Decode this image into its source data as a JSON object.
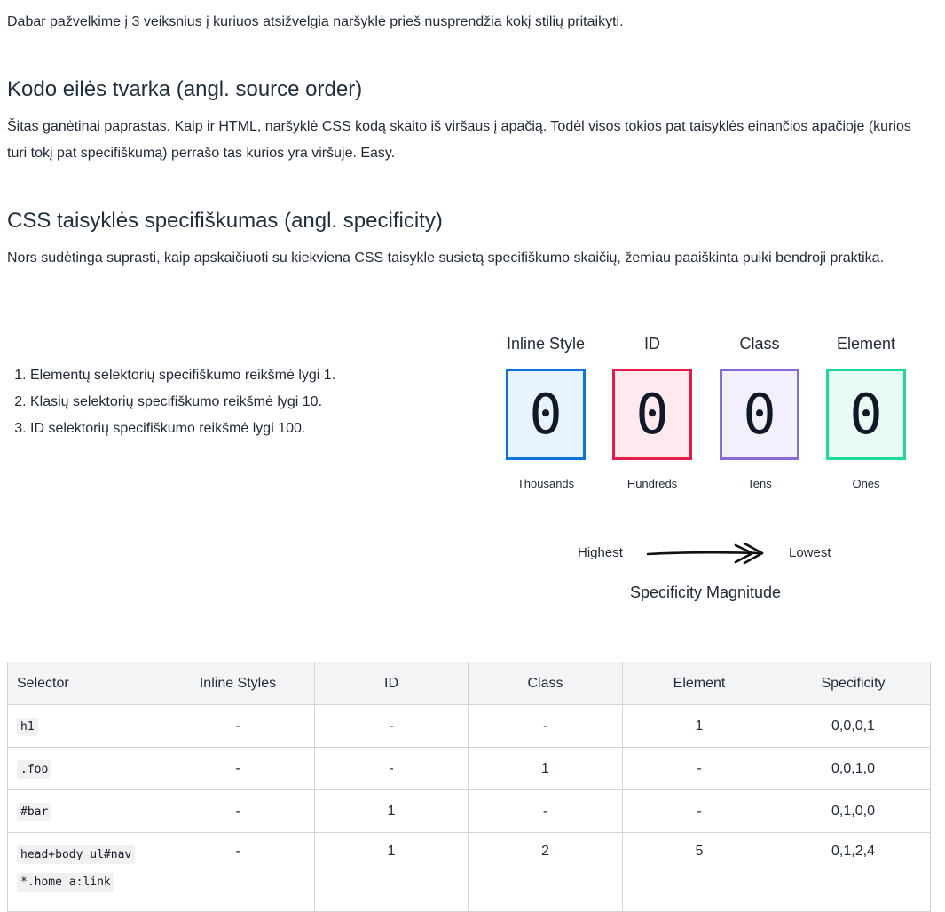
{
  "intro": "Dabar pažvelkime į 3 veiksnius į kuriuos atsižvelgia naršyklė prieš nusprendžia kokį stilių pritaikyti.",
  "section1": {
    "heading": "Kodo eilės tvarka (angl. source order)",
    "text": "Šitas ganėtinai paprastas. Kaip ir HTML, naršyklė CSS kodą skaito iš viršaus į apačią. Todėl visos tokios pat taisyklės einančios apačioje (kurios turi tokį pat specifiškumą) perrašo tas kurios yra viršuje. Easy."
  },
  "section2": {
    "heading": "CSS taisyklės specifiškumas (angl. specificity)",
    "text": "Nors sudėtinga suprasti, kaip apskaičiuoti su kiekviena CSS taisykle susietą specifiškumo skaičių, žemiau paaiškinta puiki bendroji praktika."
  },
  "rules": [
    "Elementų selektorių specifiškumo reikšmė lygi 1.",
    "Klasių selektorių specifiškumo reikšmė lygi 10.",
    "ID selektorių specifiškumo reikšmė lygi 100."
  ],
  "diagram": {
    "columns": [
      {
        "title": "Inline Style",
        "value": "0",
        "sub": "Thousands",
        "border": "#0a74d9",
        "fill": "#e8f4fd"
      },
      {
        "title": "ID",
        "value": "0",
        "sub": "Hundreds",
        "border": "#e01e46",
        "fill": "#fde9ee"
      },
      {
        "title": "Class",
        "value": "0",
        "sub": "Tens",
        "border": "#8a6ad6",
        "fill": "#f3f0fd"
      },
      {
        "title": "Element",
        "value": "0",
        "sub": "Ones",
        "border": "#1fd99a",
        "fill": "#e6fbf3"
      }
    ],
    "highest": "Highest",
    "lowest": "Lowest",
    "magnitude": "Specificity Magnitude"
  },
  "table": {
    "headers": [
      "Selector",
      "Inline Styles",
      "ID",
      "Class",
      "Element",
      "Specificity"
    ],
    "rows": [
      {
        "selector": [
          "h1"
        ],
        "inline": "-",
        "id": "-",
        "class": "-",
        "element": "1",
        "specificity": "0,0,0,1"
      },
      {
        "selector": [
          ".foo"
        ],
        "inline": "-",
        "id": "-",
        "class": "1",
        "element": "-",
        "specificity": "0,0,1,0"
      },
      {
        "selector": [
          "#bar"
        ],
        "inline": "-",
        "id": "1",
        "class": "-",
        "element": "-",
        "specificity": "0,1,0,0"
      },
      {
        "selector": [
          "head+body ul#nav",
          "*.home a:link"
        ],
        "inline": "-",
        "id": "1",
        "class": "2",
        "element": "5",
        "specificity": "0,1,2,4"
      }
    ]
  }
}
